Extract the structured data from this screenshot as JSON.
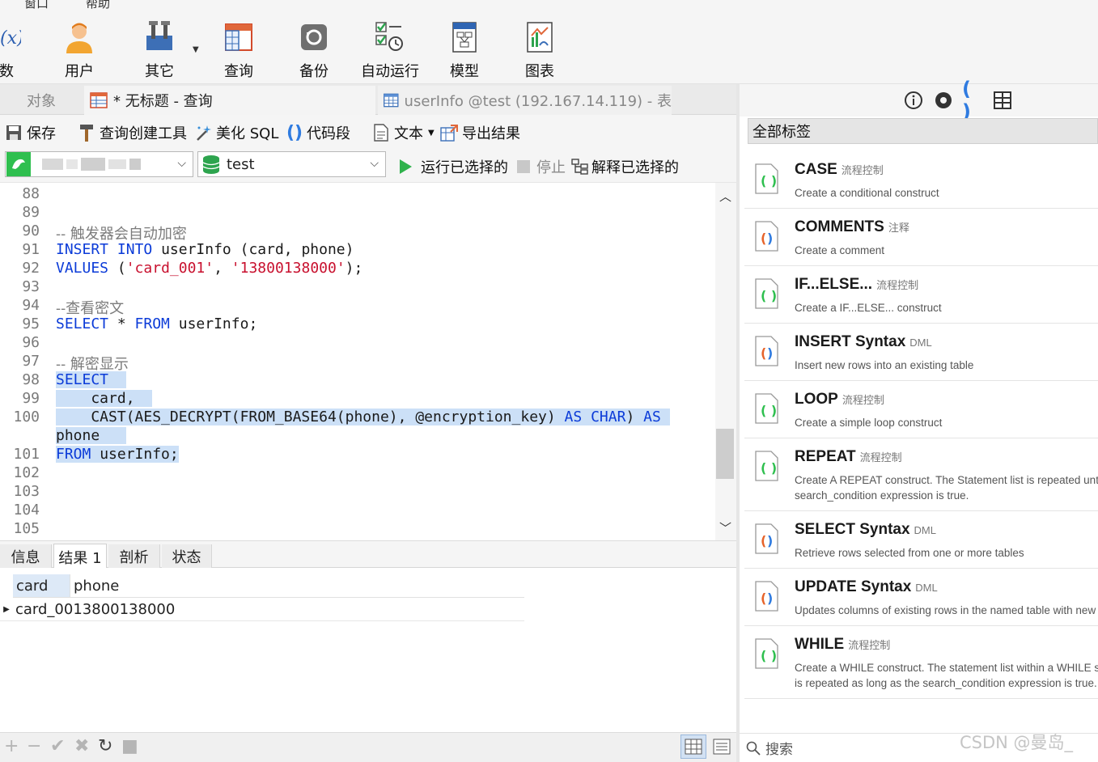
{
  "menu": {
    "items": [
      "窗口",
      "帮助"
    ]
  },
  "toolbar": {
    "buttons": [
      {
        "label": "函数",
        "icon": "function-icon"
      },
      {
        "label": "用户",
        "icon": "user-icon"
      },
      {
        "label": "其它",
        "icon": "tools-icon"
      },
      {
        "label": "查询",
        "icon": "query-icon"
      },
      {
        "label": "备份",
        "icon": "backup-icon"
      },
      {
        "label": "自动运行",
        "icon": "automation-icon"
      },
      {
        "label": "模型",
        "icon": "model-icon"
      },
      {
        "label": "图表",
        "icon": "chart-icon"
      }
    ]
  },
  "tabs": {
    "objects": "对象",
    "query": "* 无标题 - 查询",
    "table": "userInfo @test (192.167.14.119) - 表"
  },
  "editor_toolbar": {
    "save": "保存",
    "query_builder": "查询创建工具",
    "beautify": "美化 SQL",
    "snippet": "代码段",
    "text": "文本",
    "export": "导出结果"
  },
  "connection": {
    "database": "test",
    "run_selected": "运行已选择的",
    "stop": "停止",
    "explain_selected": "解释已选择的"
  },
  "editor": {
    "lines": [
      {
        "n": "88"
      },
      {
        "n": "89"
      },
      {
        "n": "90",
        "comment": "-- 触发器会自动加密"
      },
      {
        "n": "91",
        "k1": "INSERT",
        "k2": "INTO",
        "rest": " userInfo (card, phone)"
      },
      {
        "n": "92",
        "k1": "VALUES",
        "p1": " (",
        "s1": "'card_001'",
        "p2": ", ",
        "s2": "'13800138000'",
        "p3": ");"
      },
      {
        "n": "93"
      },
      {
        "n": "94",
        "comment": "--查看密文"
      },
      {
        "n": "95",
        "k1": "SELECT",
        "rest": " * ",
        "k2": "FROM",
        "rest2": " userInfo;"
      },
      {
        "n": "96"
      },
      {
        "n": "97",
        "comment": "-- 解密显示"
      },
      {
        "n": "98",
        "k1": "SELECT"
      },
      {
        "n": "99",
        "text": "    card,"
      },
      {
        "n": "100",
        "pre": "    CAST(AES_DECRYPT(FROM_BASE64(phone), @encryption_key) ",
        "k1": "AS",
        "mid": " ",
        "k2": "CHAR",
        "post": ") ",
        "k3": "AS"
      },
      {
        "n": "",
        "text": "phone"
      },
      {
        "n": "101",
        "k1": "FROM",
        "rest": " userInfo;"
      },
      {
        "n": "102"
      },
      {
        "n": "103"
      },
      {
        "n": "104"
      },
      {
        "n": "105"
      }
    ]
  },
  "result_tabs": [
    "信息",
    "结果 1",
    "剖析",
    "状态"
  ],
  "result_grid": {
    "columns": [
      "card",
      "phone"
    ],
    "rows": [
      [
        "card_001",
        "3800138000"
      ]
    ]
  },
  "right_panel": {
    "header": "全部标签",
    "snippets": [
      {
        "title": "CASE",
        "tag": "流程控制",
        "desc": "Create a conditional construct"
      },
      {
        "title": "COMMENTS",
        "tag": "注释",
        "desc": "Create a comment"
      },
      {
        "title": "IF...ELSE...",
        "tag": "流程控制",
        "desc": "Create a IF...ELSE... construct"
      },
      {
        "title": "INSERT Syntax",
        "tag": "DML",
        "desc": "Insert new rows into an existing table"
      },
      {
        "title": "LOOP",
        "tag": "流程控制",
        "desc": "Create a simple loop construct"
      },
      {
        "title": "REPEAT",
        "tag": "流程控制",
        "desc": "Create A REPEAT construct. The Statement list is repeated until the search_condition expression is true.",
        "desc1": "Create A REPEAT construct. The Statement list is repeated until the",
        "desc2": "search_condition expression is true."
      },
      {
        "title": "SELECT Syntax",
        "tag": "DML",
        "desc": "Retrieve rows selected from one or more tables"
      },
      {
        "title": "UPDATE Syntax",
        "tag": "DML",
        "desc": "Updates columns of existing rows in the named table with new values"
      },
      {
        "title": "WHILE",
        "tag": "流程控制",
        "desc": "Create a WHILE construct. The statement list within a WHILE statement is repeated as long as the search_condition expression is true.",
        "desc1": "Create a WHILE construct. The statement list within a WHILE statement",
        "desc2": "is repeated as long as the search_condition expression is true."
      }
    ],
    "search_placeholder": "搜索"
  },
  "watermark": "CSDN @曼岛_",
  "colors": {
    "keyword": "#0b3bd8",
    "string": "#c8102e",
    "selection": "#cce0f7",
    "snippet_icon_green": "#2fbf4f"
  }
}
